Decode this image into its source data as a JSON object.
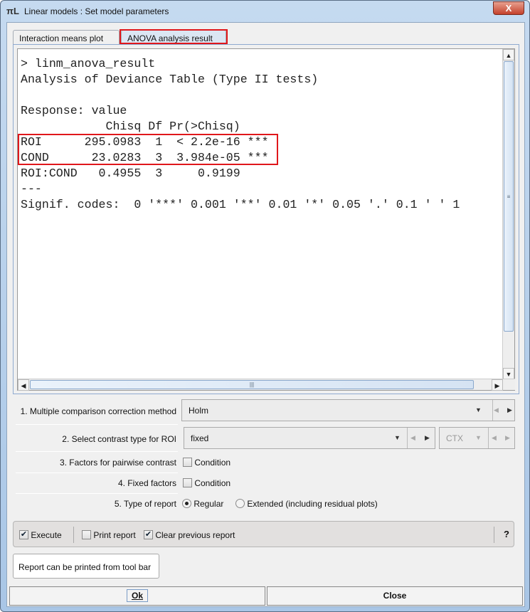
{
  "window": {
    "title": "Linear models :  Set model parameters",
    "close_label": "X",
    "app_icon": "pmod-icon"
  },
  "tabs": [
    {
      "label": "Interaction means plot",
      "active": false
    },
    {
      "label": "ANOVA analysis result",
      "active": true
    }
  ],
  "output": {
    "lines": [
      "> linm_anova_result",
      "Analysis of Deviance Table (Type II tests)",
      "",
      "Response: value",
      "            Chisq Df Pr(>Chisq)",
      "ROI      295.0983  1  < 2.2e-16 ***",
      "COND      23.0283  3  3.984e-05 ***",
      "ROI:COND   0.4955  3     0.9199",
      "---",
      "Signif. codes:  0 '***' 0.001 '**' 0.01 '*' 0.05 '.' 0.1 ' ' 1"
    ]
  },
  "highlight_color": "#e0171b",
  "form": {
    "correction": {
      "label": "1. Multiple comparison correction method",
      "value": "Holm"
    },
    "contrast": {
      "label": "2. Select contrast type for ROI",
      "value": "fixed",
      "secondary_value": "CTX"
    },
    "pairwise": {
      "label": "3. Factors for pairwise contrast",
      "option": "Condition",
      "checked": false
    },
    "fixed": {
      "label": "4. Fixed factors",
      "option": "Condition",
      "checked": false
    },
    "report_type": {
      "label": "5. Type of report",
      "options": [
        "Regular",
        "Extended (including residual plots)"
      ],
      "selected": "Regular"
    }
  },
  "toolbar": {
    "execute": {
      "label": "Execute",
      "checked": true
    },
    "print": {
      "label": "Print report",
      "checked": false
    },
    "clear": {
      "label": "Clear previous report",
      "checked": true
    },
    "help": "?"
  },
  "tooltip": "Report can be printed from tool bar",
  "buttons": {
    "ok": "Ok",
    "close": "Close"
  }
}
